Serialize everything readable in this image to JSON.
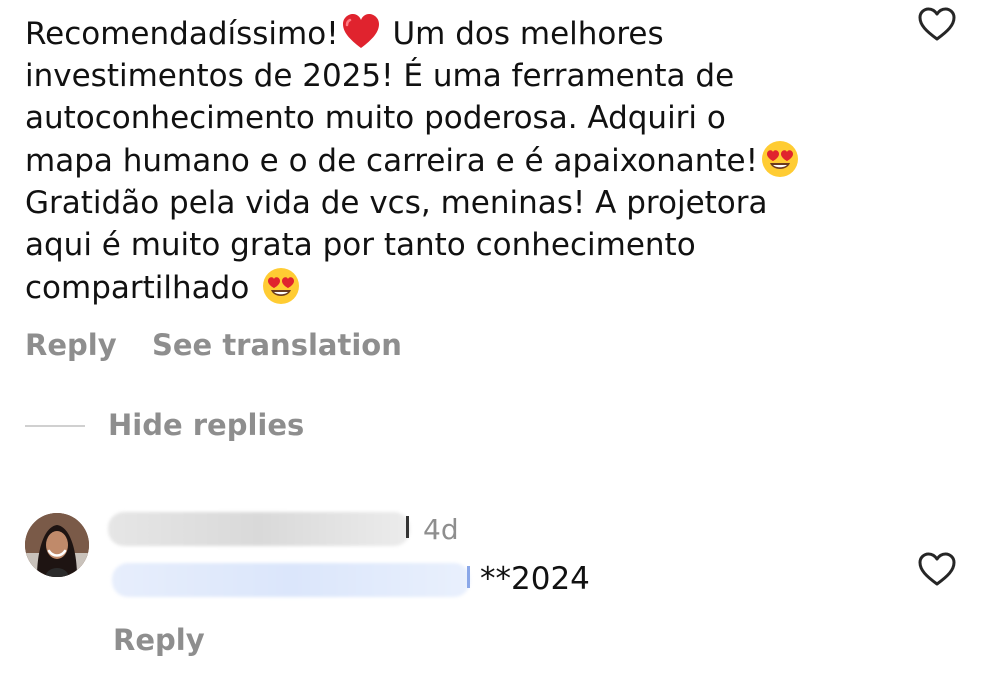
{
  "comment": {
    "lines": [
      [
        "Recomendadíssimo!",
        "heart",
        " Um dos melhores"
      ],
      [
        "investimentos de 2025! É uma ferramenta de"
      ],
      [
        "autoconhecimento muito poderosa. Adquiri o"
      ],
      [
        "mapa humano e o de carreira e é apaixonante!",
        "heart-eyes"
      ],
      [
        "Gratidão pela vida de vcs, meninas! A projetora"
      ],
      [
        "aqui é muito grata por tanto conhecimento"
      ],
      [
        "compartilhado ",
        "heart-eyes"
      ]
    ],
    "reply_label": "Reply",
    "translation_label": "See translation",
    "like_icon": "heart-outline-icon"
  },
  "replies_toggle": {
    "label": "Hide replies"
  },
  "reply": {
    "time": "4d",
    "text": "**2024",
    "reply_label": "Reply",
    "like_icon": "heart-outline-icon"
  },
  "colors": {
    "text": "#111111",
    "muted": "#8e8e8e",
    "heart_red": "#e0232e",
    "emoji_yellow": "#ffcc33"
  }
}
